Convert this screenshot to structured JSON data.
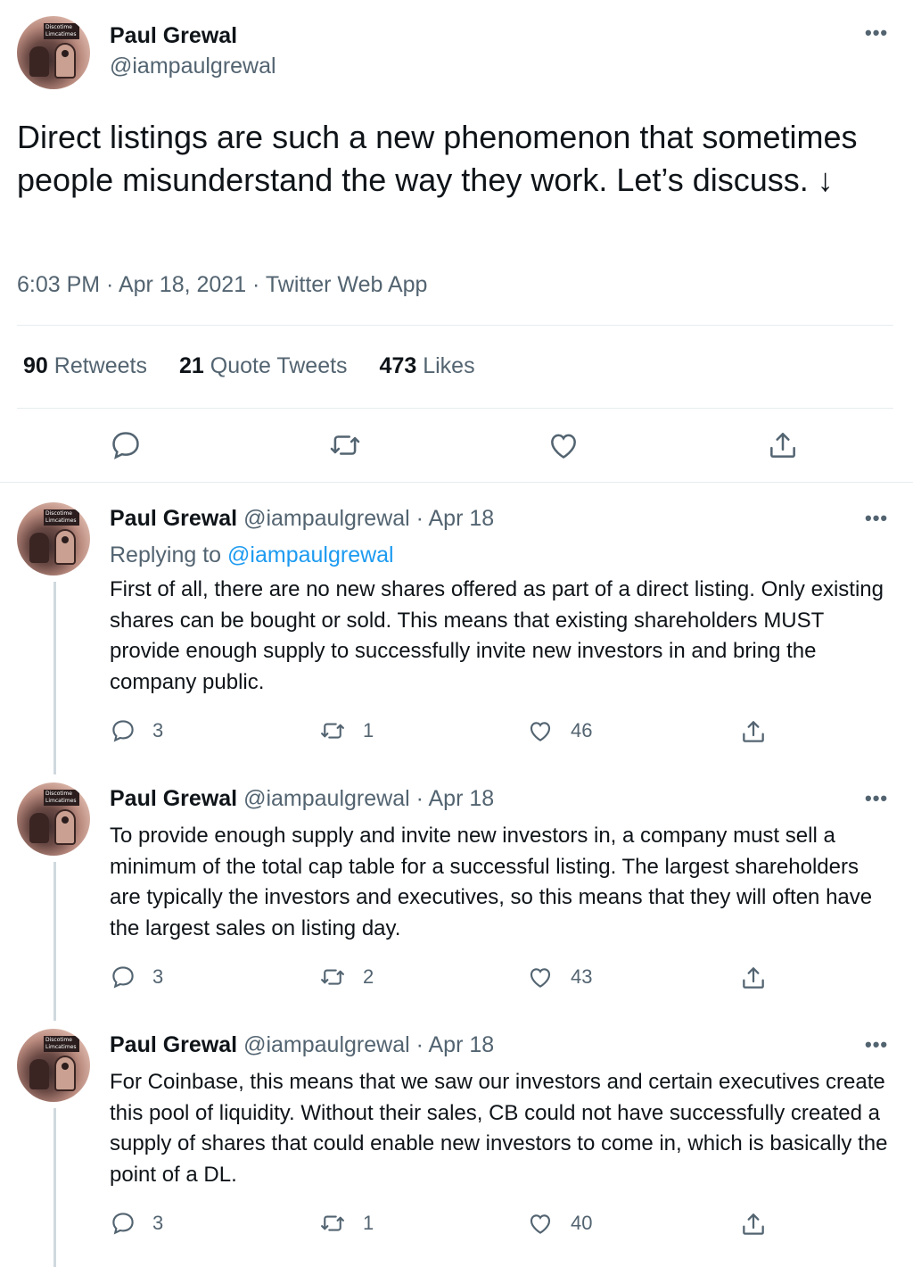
{
  "main": {
    "name": "Paul Grewal",
    "handle": "@iampaulgrewal",
    "text": "Direct listings are such a new phenomenon that sometimes people misunderstand the way they work. Let’s discuss. ↓",
    "meta": "6:03 PM · Apr 18, 2021 · Twitter Web App",
    "stats": {
      "retweets_count": "90",
      "retweets_label": "Retweets",
      "quotes_count": "21",
      "quotes_label": "Quote Tweets",
      "likes_count": "473",
      "likes_label": "Likes"
    }
  },
  "avatar_text": "Discotime Limcatimes",
  "replies": [
    {
      "name": "Paul Grewal",
      "handle_date": "@iampaulgrewal · Apr 18",
      "replying_prefix": "Replying to",
      "replying_to": "@iampaulgrewal",
      "text": "First of all, there are no new shares offered as part of a direct listing. Only existing shares can be bought or sold. This means that existing shareholders MUST provide  enough supply to successfully invite new investors in and bring the company public.",
      "replies": "3",
      "retweets": "1",
      "likes": "46"
    },
    {
      "name": "Paul Grewal",
      "handle_date": "@iampaulgrewal · Apr 18",
      "text": "To provide enough supply and invite new investors in, a company must sell a minimum of the total cap table for a successful listing. The largest shareholders are typically the investors and executives, so this means that they will often have the largest sales on listing day.",
      "replies": "3",
      "retweets": "2",
      "likes": "43"
    },
    {
      "name": "Paul Grewal",
      "handle_date": "@iampaulgrewal · Apr 18",
      "text": "For Coinbase, this means that we saw our investors and  certain executives create this pool of liquidity. Without their sales, CB could not have successfully created a supply of shares that could enable new investors to come in, which is basically the point of a DL.",
      "replies": "3",
      "retweets": "1",
      "likes": "40"
    }
  ],
  "more_label": "•••",
  "colors": {
    "text": "#0f1419",
    "secondary": "#536471",
    "link": "#1d9bf0",
    "divider": "#e6ecf0"
  }
}
